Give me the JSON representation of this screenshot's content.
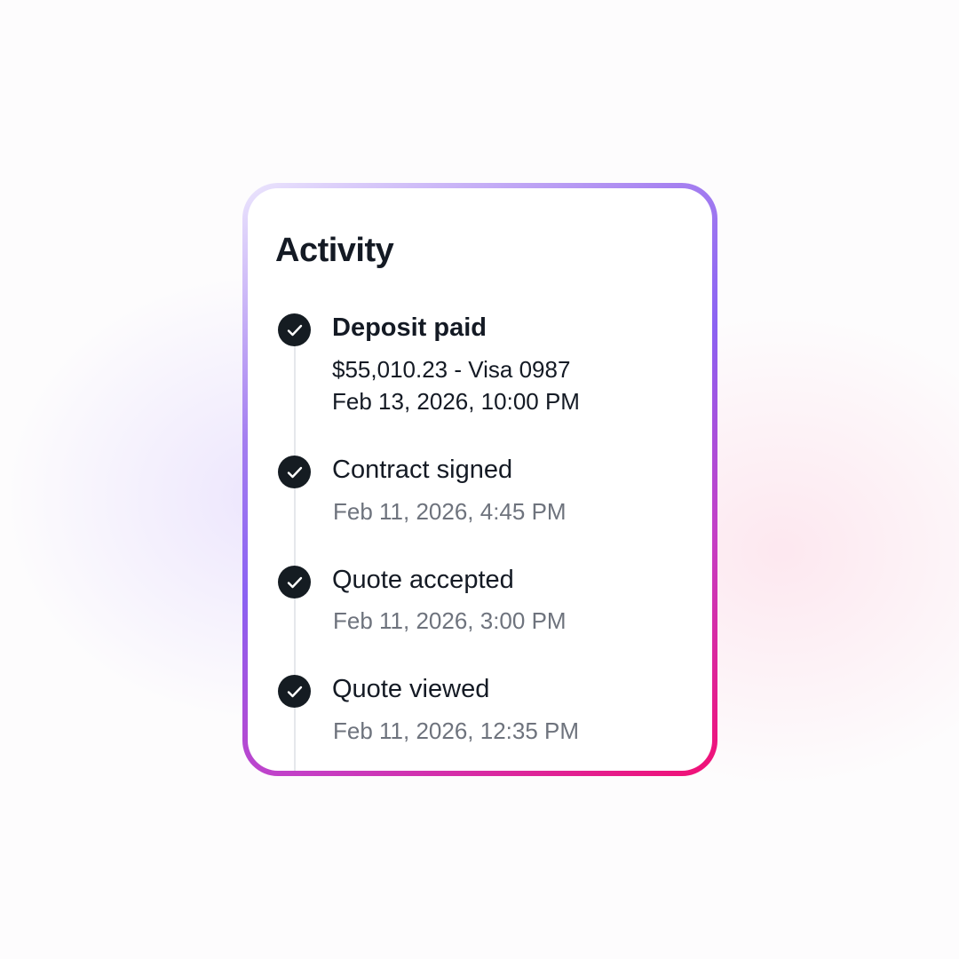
{
  "colors": {
    "border_gradient": [
      "#ece6fd",
      "#a47ef0",
      "#8b62f2",
      "#c43fc6",
      "#f20f74"
    ],
    "check_bg": "#151c22",
    "text_primary": "#141a24",
    "text_muted": "#6e737d",
    "timeline_line": "#e5e7eb"
  },
  "activity": {
    "title": "Activity",
    "events": [
      {
        "icon": "check-circle-icon",
        "title": "Deposit paid",
        "emphasis": true,
        "payment": "$55,010.23 - Visa 0987",
        "timestamp": "Feb 13, 2026, 10:00 PM"
      },
      {
        "icon": "check-circle-icon",
        "title": "Contract signed",
        "timestamp": "Feb 11, 2026, 4:45 PM"
      },
      {
        "icon": "check-circle-icon",
        "title": "Quote accepted",
        "timestamp": "Feb 11, 2026, 3:00 PM"
      },
      {
        "icon": "check-circle-icon",
        "title": "Quote viewed",
        "timestamp": "Feb 11, 2026, 12:35 PM"
      }
    ]
  }
}
